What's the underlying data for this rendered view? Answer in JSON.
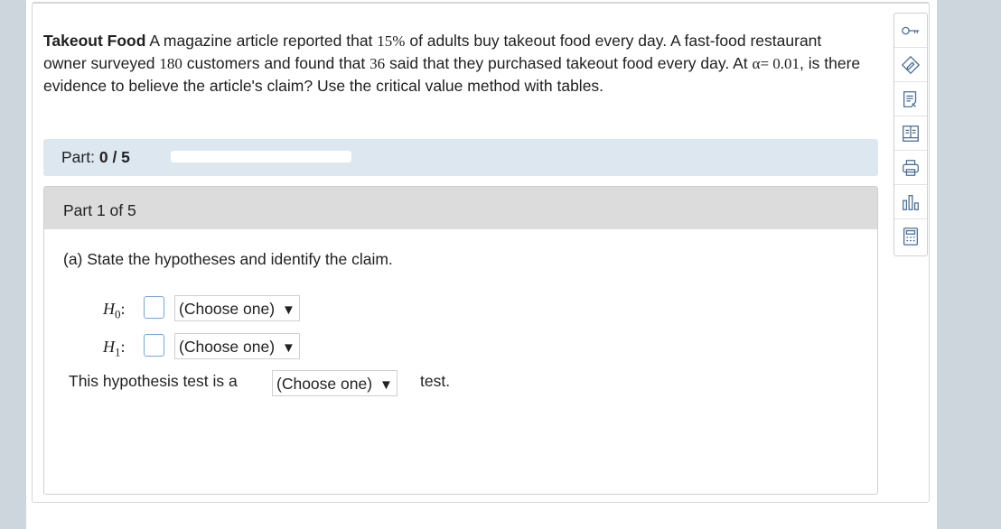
{
  "problem": {
    "title": "Takeout Food",
    "text_1": "A magazine article reported that",
    "percent": "15%",
    "text_2": "of adults buy takeout food every day. A fast-food restaurant owner surveyed",
    "surveyed": "180",
    "text_3": "customers and found that",
    "found": "36",
    "text_4": "said that they purchased takeout food every day. At",
    "alpha_sym": "α",
    "alpha_eq": "= 0.01",
    "text_5": ", is there evidence to believe the article's claim? Use the critical value method with tables."
  },
  "part_bar": {
    "label": "Part:",
    "progress": "0 / 5",
    "progress_fraction": 0
  },
  "part": {
    "heading": "Part 1 of 5",
    "question": "(a) State the hypotheses and identify the claim.",
    "h0_label": "H",
    "h0_sub": "0",
    "h1_label": "H",
    "h1_sub": "1",
    "colon": ":",
    "h0_select": "(Choose one)",
    "h1_select": "(Choose one)",
    "test_pre": "This hypothesis test is a",
    "test_select": "(Choose one)",
    "test_post": "test.",
    "arrow": "▼"
  },
  "toolbar": {
    "items": [
      "key-icon",
      "pencil-diamond-icon",
      "document-icon",
      "book-icon",
      "print-icon",
      "bar-chart-icon",
      "calculator-icon"
    ]
  }
}
